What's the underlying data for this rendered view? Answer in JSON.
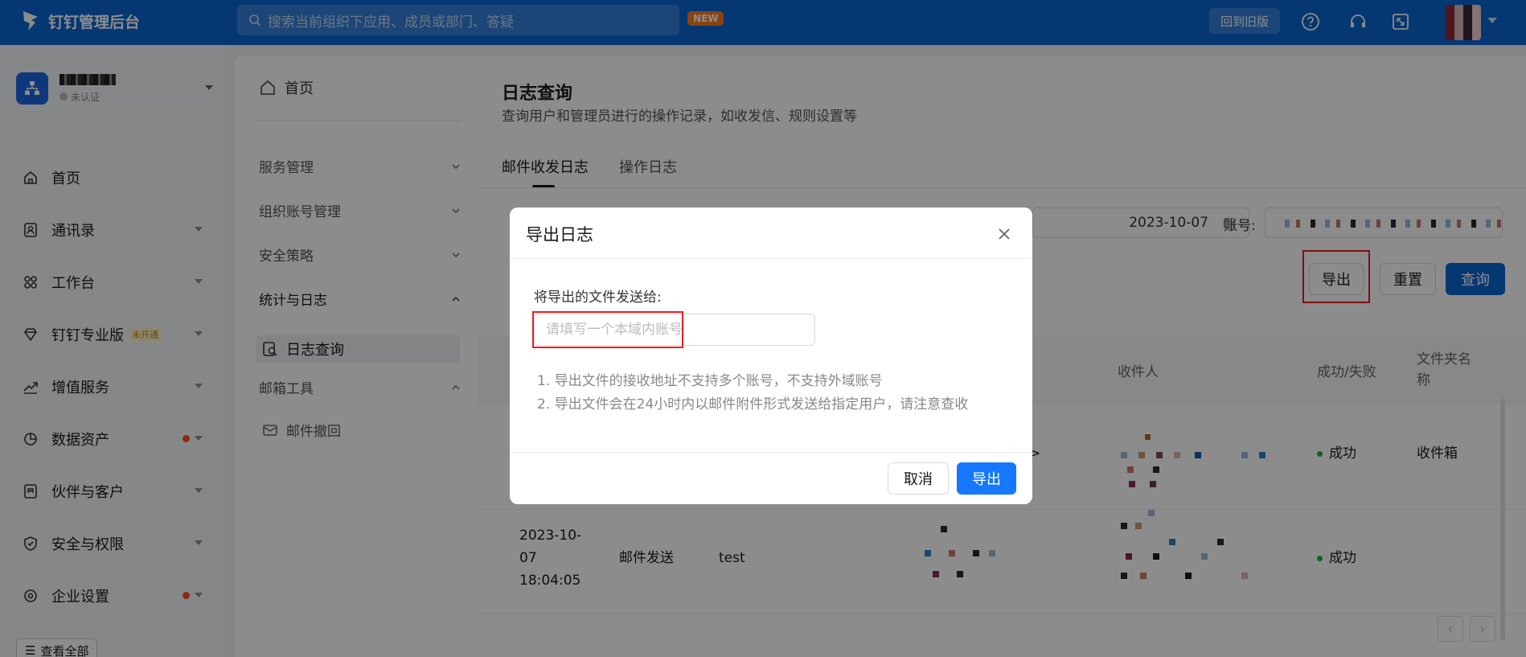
{
  "topbar": {
    "brand": "钉钉管理后台",
    "search_placeholder": "搜索当前组织下应用、成员或部门、答疑",
    "new_badge": "NEW",
    "old_version": "回到旧版"
  },
  "sidebar": {
    "org_status": "未认证",
    "items": [
      {
        "label": "首页",
        "icon": "home-icon"
      },
      {
        "label": "通讯录",
        "icon": "contacts-icon"
      },
      {
        "label": "工作台",
        "icon": "workbench-icon"
      },
      {
        "label": "钉钉专业版",
        "icon": "diamond-icon",
        "tag": "未开通"
      },
      {
        "label": "增值服务",
        "icon": "trend-icon"
      },
      {
        "label": "数据资产",
        "icon": "data-icon"
      },
      {
        "label": "伙伴与客户",
        "icon": "partner-icon"
      },
      {
        "label": "安全与权限",
        "icon": "shield-icon"
      },
      {
        "label": "企业设置",
        "icon": "settings-icon"
      }
    ],
    "view_all": "查看全部"
  },
  "submenu": {
    "home": "首页",
    "groups": [
      "服务管理",
      "组织账号管理",
      "安全策略",
      "统计与日志",
      "邮箱工具"
    ],
    "active_item": "日志查询",
    "mail_child": "邮件撤回"
  },
  "main": {
    "title": "日志查询",
    "description": "查询用户和管理员进行的操作记录，如收发信、规则设置等",
    "tabs": [
      "邮件收发日志",
      "操作日志"
    ],
    "date_value": "2023-10-07",
    "account_label": "账号:",
    "buttons": {
      "export": "导出",
      "reset": "重置",
      "query": "查询"
    },
    "columns": {
      "recipient": "收件人",
      "status": "成功/失败",
      "folder": "文件夹名称"
    },
    "rows": [
      {
        "status": "成功",
        "folder": "收件箱",
        "arrow": ">"
      },
      {
        "date": "2023-10-07 18:04:05",
        "type": "邮件发送",
        "subject": "test",
        "status": "成功"
      }
    ]
  },
  "dialog": {
    "title": "导出日志",
    "label": "将导出的文件发送给:",
    "input_placeholder": "请填写一个本域内账号",
    "notes": [
      "1. 导出文件的接收地址不支持多个账号，不支持外域账号",
      "2. 导出文件会在24小时内以邮件附件形式发送给指定用户，请注意查收"
    ],
    "cancel": "取消",
    "confirm": "导出"
  },
  "colors": {
    "brand": "#0a64d2",
    "highlight": "#e81e1e",
    "success": "#26b04a"
  }
}
